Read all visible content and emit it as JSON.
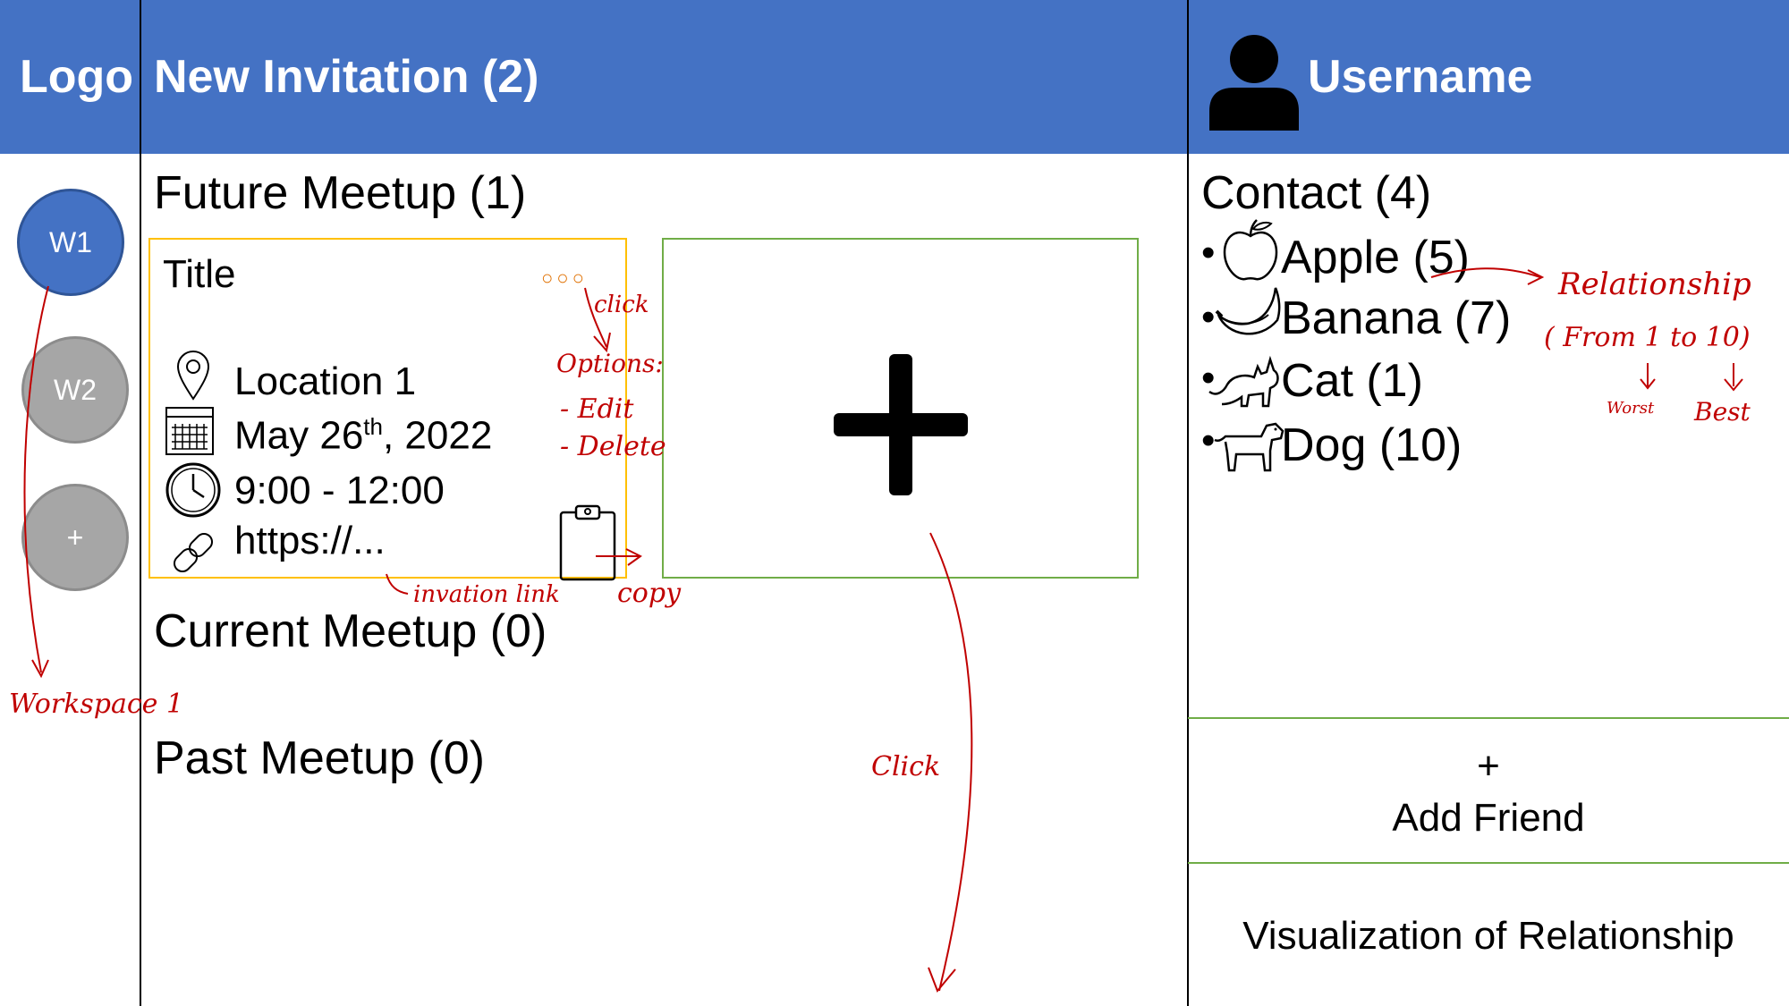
{
  "header": {
    "logo": "Logo",
    "title": "New Invitation (2)",
    "username": "Username"
  },
  "workspaces": [
    {
      "label": "W1",
      "active": true
    },
    {
      "label": "W2",
      "active": false
    },
    {
      "label": "+",
      "active": false
    }
  ],
  "sections": {
    "future": "Future Meetup (1)",
    "current": "Current Meetup (0)",
    "past": "Past Meetup (0)"
  },
  "meetup_card": {
    "title": "Title",
    "location": "Location 1",
    "date_prefix": "May 26",
    "date_sup": "th",
    "date_suffix": ", 2022",
    "time": "9:00 - 12:00",
    "link": "https://...",
    "more_glyph": "○○○"
  },
  "add_meetup_glyph": "+",
  "contacts": {
    "heading": "Contact (4)",
    "items": [
      {
        "label": "Apple (5)",
        "icon": "apple-icon"
      },
      {
        "label": "Banana (7)",
        "icon": "banana-icon"
      },
      {
        "label": "Cat (1)",
        "icon": "cat-icon"
      },
      {
        "label": "Dog (10)",
        "icon": "dog-icon"
      }
    ]
  },
  "add_friend": {
    "plus": "+",
    "label": "Add Friend"
  },
  "visualization_label": "Visualization of Relationship",
  "annotations": {
    "click_options": "click",
    "options": "Options:",
    "edit": "- Edit",
    "delete": "- Delete",
    "invitation_link": "invation link",
    "copy": "copy",
    "workspace": "Workspace 1",
    "click_add": "Click",
    "relationship": "Relationship",
    "range": "( From 1 to 10)",
    "worst": "Worst",
    "best": "Best"
  },
  "colors": {
    "header_bg": "#4472c4",
    "card_border": "#ffc000",
    "add_border": "#70ad47",
    "annotation": "#c00000",
    "workspace_active": "#4472c4",
    "workspace_inactive": "#a6a6a6"
  }
}
